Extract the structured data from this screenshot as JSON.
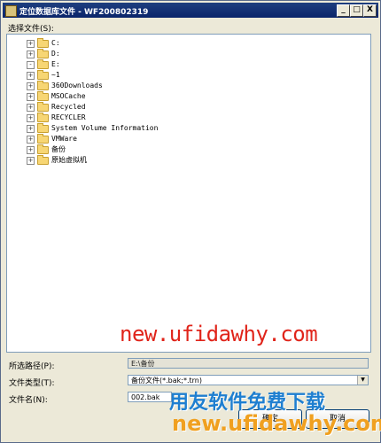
{
  "window": {
    "title": "定位数据库文件 - WF200802319",
    "minimize": "_",
    "maximize": "□",
    "close": "X"
  },
  "select_file_label": "选择文件(S):",
  "tree": [
    {
      "label": "C:",
      "expander": "+"
    },
    {
      "label": "D:",
      "expander": "+"
    },
    {
      "label": "E:",
      "expander": "-"
    },
    {
      "label": "~1",
      "expander": "+"
    },
    {
      "label": "360Downloads",
      "expander": "+"
    },
    {
      "label": "MSOCache",
      "expander": "+"
    },
    {
      "label": "Recycled",
      "expander": "+"
    },
    {
      "label": "RECYCLER",
      "expander": "+"
    },
    {
      "label": "System Volume Information",
      "expander": "+"
    },
    {
      "label": "VMWare",
      "expander": "+"
    },
    {
      "label": "备份",
      "expander": "+"
    },
    {
      "label": "原始虚拟机",
      "expander": "+"
    }
  ],
  "path_label": "所选路径(P):",
  "path_value": "E:\\备份",
  "type_label": "文件类型(T):",
  "type_value": "备份文件(*.bak;*.trn)",
  "name_label": "文件名(N):",
  "name_value": "002.bak",
  "ok_button": "确定",
  "cancel_button": "取消",
  "watermark": {
    "url": "new.ufidawhy.com",
    "slogan": "用友软件免费下载",
    "url2": "new.ufidawhy.com"
  }
}
